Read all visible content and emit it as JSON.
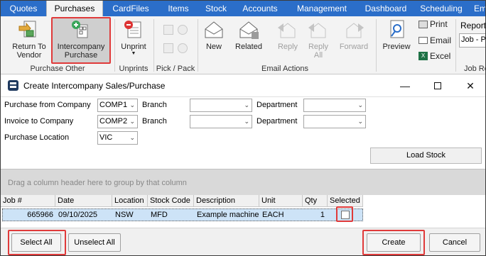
{
  "tabs": [
    "Quotes",
    "Purchases",
    "CardFiles",
    "Items",
    "Stock",
    "Accounts",
    "Management",
    "Dashboard",
    "Scheduling",
    "Email"
  ],
  "active_tab": "Purchases",
  "ribbon": {
    "return_to_vendor": [
      "Return To",
      "Vendor"
    ],
    "intercompany_purchase": [
      "Intercompany",
      "Purchase"
    ],
    "group_purchase_other": "Purchase Other",
    "unprint": "Unprint",
    "group_unprints": "Unprints",
    "group_pick_pack": "Pick / Pack",
    "new": "New",
    "related": "Related",
    "reply": "Reply",
    "reply_all": [
      "Reply",
      "All"
    ],
    "forward": "Forward",
    "group_email_actions": "Email Actions",
    "preview": "Preview",
    "print": "Print",
    "email": "Email",
    "excel": "Excel",
    "report_label": "Report",
    "report_value": "Job - P",
    "group_job_reports": "Job Re"
  },
  "dialog": {
    "title": "Create Intercompany Sales/Purchase",
    "purchase_from_company_label": "Purchase from Company",
    "purchase_from_company_value": "COMP1",
    "invoice_to_company_label": "Invoice to Company",
    "invoice_to_company_value": "COMP2",
    "purchase_location_label": "Purchase Location",
    "purchase_location_value": "VIC",
    "branch_label": "Branch",
    "department_label": "Department",
    "load_stock": "Load Stock",
    "group_hint": "Drag a column header here to group by that column"
  },
  "grid": {
    "columns": [
      "Job #",
      "Date",
      "Location",
      "Stock Code",
      "Description",
      "Unit",
      "Qty",
      "Selected"
    ],
    "rows": [
      {
        "job": "665966",
        "date": "09/10/2025",
        "location": "NSW",
        "stock_code": "MFD",
        "description": "Example machine",
        "unit": "EACH",
        "qty": "1",
        "selected": false
      }
    ]
  },
  "footer": {
    "select_all": "Select All",
    "unselect_all": "Unselect All",
    "create": "Create",
    "cancel": "Cancel"
  },
  "colors": {
    "tab_blue": "#2b6ec9",
    "highlight_red": "#e03a3a",
    "row_selected": "#cde3f7"
  }
}
